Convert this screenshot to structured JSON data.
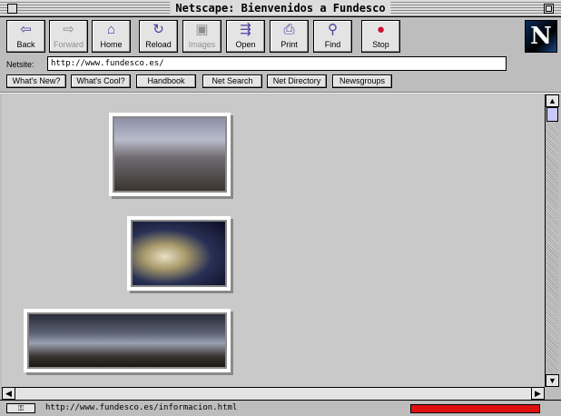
{
  "window": {
    "title": "Netscape: Bienvenidos a Fundesco"
  },
  "toolbar": {
    "buttons": [
      {
        "label": "Back",
        "icon": "back-arrow-icon",
        "glyph": "⇦",
        "enabled": true
      },
      {
        "label": "Forward",
        "icon": "forward-arrow-icon",
        "glyph": "⇨",
        "enabled": false
      },
      {
        "label": "Home",
        "icon": "home-icon",
        "glyph": "⌂",
        "enabled": true
      },
      {
        "label": "Reload",
        "icon": "reload-icon",
        "glyph": "↻",
        "enabled": true
      },
      {
        "label": "Images",
        "icon": "images-icon",
        "glyph": "▣",
        "enabled": false
      },
      {
        "label": "Open",
        "icon": "open-icon",
        "glyph": "⇶",
        "enabled": true
      },
      {
        "label": "Print",
        "icon": "print-icon",
        "glyph": "⎙",
        "enabled": true
      },
      {
        "label": "Find",
        "icon": "find-binoculars-icon",
        "glyph": "⚲",
        "enabled": true
      },
      {
        "label": "Stop",
        "icon": "stop-icon",
        "glyph": "●",
        "enabled": true
      }
    ],
    "logo": "N"
  },
  "location": {
    "label": "Netsite:",
    "url": "http://www.fundesco.es/"
  },
  "directory_buttons": [
    "What's New?",
    "What's Cool?",
    "Handbook",
    "Net Search",
    "Net Directory",
    "Newsgroups"
  ],
  "status": {
    "text": "http://www.fundesco.es/informacion.html",
    "security_icon": "key-icon",
    "progress": 1.0,
    "progress_color": "#e01010"
  },
  "colors": {
    "accent": "#4a3ea0",
    "chrome": "#bdbdbd",
    "content_bg": "#c9c9c9"
  }
}
